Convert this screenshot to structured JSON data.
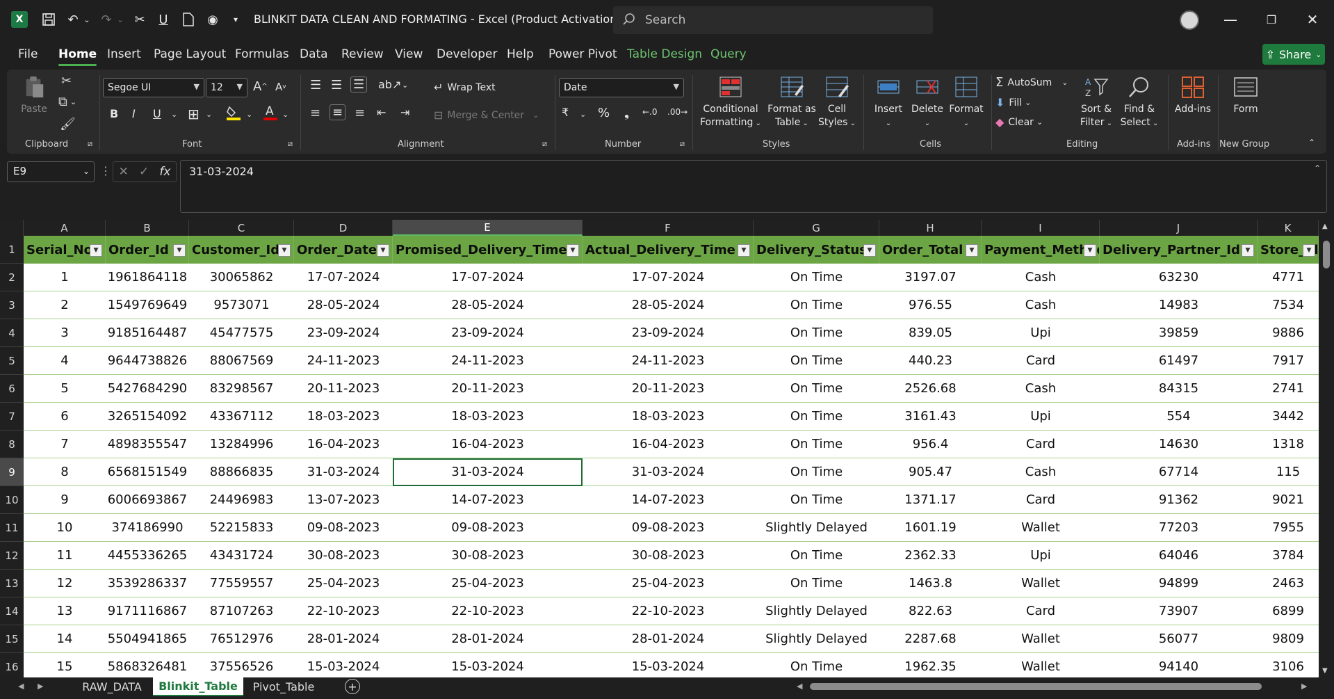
{
  "app": {
    "logo_letter": "X",
    "title": "BLINKIT DATA CLEAN AND FORMATING  -  Excel (Product Activation Fai...",
    "search_placeholder": "Search",
    "share_label": "Share"
  },
  "menu": {
    "tabs": [
      "File",
      "Home",
      "Insert",
      "Page Layout",
      "Formulas",
      "Data",
      "Review",
      "View",
      "Developer",
      "Help",
      "Power Pivot",
      "Table Design",
      "Query"
    ],
    "active": "Home"
  },
  "ribbon": {
    "clipboard": {
      "label": "Clipboard",
      "paste": "Paste"
    },
    "font": {
      "label": "Font",
      "family": "Segoe UI",
      "size": "12"
    },
    "alignment": {
      "label": "Alignment",
      "wrap_text": "Wrap Text",
      "merge_center": "Merge & Center"
    },
    "number": {
      "label": "Number",
      "format": "Date"
    },
    "styles": {
      "label": "Styles",
      "conditional": [
        "Conditional",
        "Formatting"
      ],
      "format_table": [
        "Format as",
        "Table"
      ],
      "cell_styles": [
        "Cell",
        "Styles"
      ]
    },
    "cells": {
      "label": "Cells",
      "insert": "Insert",
      "delete": "Delete",
      "format": "Format"
    },
    "editing": {
      "label": "Editing",
      "autosum": "AutoSum",
      "fill": "Fill",
      "clear": "Clear",
      "sort_filter": [
        "Sort &",
        "Filter"
      ],
      "find_select": [
        "Find &",
        "Select"
      ]
    },
    "addins": {
      "label": "Add-ins",
      "button": "Add-ins"
    },
    "newgroup": {
      "label": "New Group",
      "form": "Form"
    }
  },
  "formula_bar": {
    "name_box": "E9",
    "fx": "fx",
    "value": "31-03-2024"
  },
  "sheet": {
    "columns": [
      "A",
      "B",
      "C",
      "D",
      "E",
      "F",
      "G",
      "H",
      "I",
      "J",
      "K"
    ],
    "selected_column": "E",
    "headers": [
      "Serial_No",
      "Order_Id",
      "Customer_Id",
      "Order_Date",
      "Promised_Delivery_Time",
      "Actual_Delivery_Time",
      "Delivery_Status",
      "Order_Total",
      "Payment_Method",
      "Delivery_Partner_Id",
      "Store_Id"
    ],
    "row_numbers": [
      "1",
      "2",
      "3",
      "4",
      "5",
      "6",
      "7",
      "8",
      "9",
      "10",
      "11",
      "12",
      "13",
      "14",
      "15",
      "16"
    ],
    "selected_row": "9",
    "rows": [
      [
        "1",
        "1961864118",
        "30065862",
        "17-07-2024",
        "17-07-2024",
        "17-07-2024",
        "On Time",
        "3197.07",
        "Cash",
        "63230",
        "4771"
      ],
      [
        "2",
        "1549769649",
        "9573071",
        "28-05-2024",
        "28-05-2024",
        "28-05-2024",
        "On Time",
        "976.55",
        "Cash",
        "14983",
        "7534"
      ],
      [
        "3",
        "9185164487",
        "45477575",
        "23-09-2024",
        "23-09-2024",
        "23-09-2024",
        "On Time",
        "839.05",
        "Upi",
        "39859",
        "9886"
      ],
      [
        "4",
        "9644738826",
        "88067569",
        "24-11-2023",
        "24-11-2023",
        "24-11-2023",
        "On Time",
        "440.23",
        "Card",
        "61497",
        "7917"
      ],
      [
        "5",
        "5427684290",
        "83298567",
        "20-11-2023",
        "20-11-2023",
        "20-11-2023",
        "On Time",
        "2526.68",
        "Cash",
        "84315",
        "2741"
      ],
      [
        "6",
        "3265154092",
        "43367112",
        "18-03-2023",
        "18-03-2023",
        "18-03-2023",
        "On Time",
        "3161.43",
        "Upi",
        "554",
        "3442"
      ],
      [
        "7",
        "4898355547",
        "13284996",
        "16-04-2023",
        "16-04-2023",
        "16-04-2023",
        "On Time",
        "956.4",
        "Card",
        "14630",
        "1318"
      ],
      [
        "8",
        "6568151549",
        "88866835",
        "31-03-2024",
        "31-03-2024",
        "31-03-2024",
        "On Time",
        "905.47",
        "Cash",
        "67714",
        "115"
      ],
      [
        "9",
        "6006693867",
        "24496983",
        "13-07-2023",
        "14-07-2023",
        "14-07-2023",
        "On Time",
        "1371.17",
        "Card",
        "91362",
        "9021"
      ],
      [
        "10",
        "374186990",
        "52215833",
        "09-08-2023",
        "09-08-2023",
        "09-08-2023",
        "Slightly Delayed",
        "1601.19",
        "Wallet",
        "77203",
        "7955"
      ],
      [
        "11",
        "4455336265",
        "43431724",
        "30-08-2023",
        "30-08-2023",
        "30-08-2023",
        "On Time",
        "2362.33",
        "Upi",
        "64046",
        "3784"
      ],
      [
        "12",
        "3539286337",
        "77559557",
        "25-04-2023",
        "25-04-2023",
        "25-04-2023",
        "On Time",
        "1463.8",
        "Wallet",
        "94899",
        "2463"
      ],
      [
        "13",
        "9171116867",
        "87107263",
        "22-10-2023",
        "22-10-2023",
        "22-10-2023",
        "Slightly Delayed",
        "822.63",
        "Card",
        "73907",
        "6899"
      ],
      [
        "14",
        "5504941865",
        "76512976",
        "28-01-2024",
        "28-01-2024",
        "28-01-2024",
        "Slightly Delayed",
        "2287.68",
        "Wallet",
        "56077",
        "9809"
      ],
      [
        "15",
        "5868326481",
        "37556526",
        "15-03-2024",
        "15-03-2024",
        "15-03-2024",
        "On Time",
        "1962.35",
        "Wallet",
        "94140",
        "3106"
      ]
    ]
  },
  "sheet_tabs": {
    "tabs": [
      "RAW_DATA",
      "Blinkit_Table",
      "Pivot_Table"
    ],
    "active": "Blinkit_Table"
  },
  "colors": {
    "table_header": "#6ca544",
    "accent": "#1f7a3d"
  }
}
